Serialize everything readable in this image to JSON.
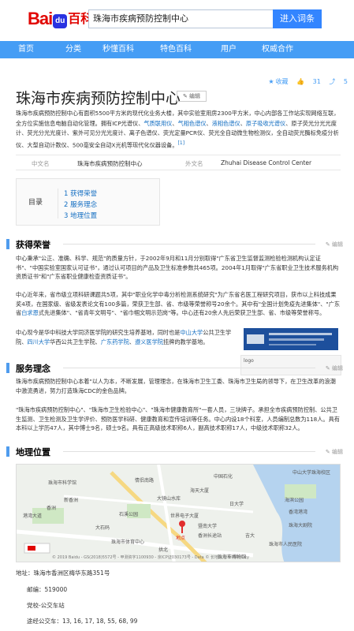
{
  "header": {
    "logo_brand": "Bai",
    "logo_paw": "du",
    "logo_suffix": "百科",
    "search_value": "珠海市疾病预防控制中心",
    "enter_button": "进入词条"
  },
  "nav": {
    "items": [
      "首页",
      "分类",
      "秒懂百科",
      "特色百科",
      "用户",
      "权威合作"
    ]
  },
  "actions": {
    "favorite": "收藏",
    "like_count": "31",
    "share_count": "5"
  },
  "title": "珠海市疾病预防控制中心",
  "edit_label": "编辑",
  "summary": {
    "text1": "珠海市疾病预防控制中心有面积5500平方米的现代化业务大楼，其中实验室用房2300平方米，中心内部各工作站实现网络互联，全方位实施信息电脑自动化管理。拥有ICP光谱仪、",
    "link1": "气质联用仪",
    "sep1": "、",
    "link2": "气相色谱仪",
    "sep2": "、",
    "link3": "液相色谱仪",
    "sep3": "、",
    "link4": "原子吸收光谱仪",
    "text2": "、原子荧光分光光度计、荧光分光光度计、紫外可见分光光度计、离子色谱仪、荧光定量PCR仪、荧光全自动微生物检测仪，全自动荧光酶标免疫分析仪、大型自动计数仪、500毫安全自动X光机等现代化仪器设备。",
    "ref": "[1]"
  },
  "basic_info": {
    "cn_name_label": "中文名",
    "cn_name_value": "珠海市疾病预防控制中心",
    "foreign_name_label": "外文名",
    "foreign_name_value": "Zhuhai Disease Control Center"
  },
  "toc": {
    "label": "目录",
    "items": [
      "1  获得荣誉",
      "2  服务理念",
      "3  地理位置"
    ]
  },
  "sections": {
    "honors": {
      "title": "获得荣誉",
      "p1": "中心秉承\"公正、准确、科学、规范\"的质量方针，于2002年9月和11月分别取得\"广东省卫生监督监测检验检测机构认定证书\"、\"中国实验室国家认可证书\"，通过认可项目的产品及卫生标准参数共465项。2004年1月取得\"广东省职业卫生技术服务机构资质证书\"和\"广东省职业健康检查资质证书\"。",
      "p2a": "中心近年来，省市级立项科研课题共5项，其中\"职业化学中毒分析检测系统研究\"为广东省名医工程研究项目，获市以上科技成果奖4项，在国家级、省级发表论文有100多篇，荣获卫生部、省、市级等荣誉称号20余个。其中有\"全国计划免疫先进集体\"、\"广东省",
      "p2link": "白求恩",
      "p2b": "式先进集体\"、\"省青年文明号\"、\"省巾帼文明示范岗\"等。中心还有20余人先后荣获卫生部、省、市级等荣誉称号。",
      "p3a": "中心现今是华中科技大学同济医学院的研究生培养基地，同时也是",
      "p3l1": "中山大学",
      "p3b": "公共卫生学院、",
      "p3l2": "四川大学",
      "p3c": "华西公共卫生学院、",
      "p3l3": "广东药学院",
      "p3d": "、",
      "p3l4": "遵义医学院",
      "p3e": "挂牌的教学基地。",
      "pic_caption": "logo"
    },
    "service": {
      "title": "服务理念",
      "p1": "珠海市疾病预防控制中心本着\"以人为本，不断发展，管理理念，在珠海市卫生工委、珠海市卫生局的领导下，在卫生改革的浪潮中激流勇进，努力打造珠海CDC的金色品牌。",
      "p2": "\"珠海市疾病预防控制中心\"、\"珠海市卫生检验中心\"、\"珠海市健康教育所\"一套人员，三块牌子。承担全市疾病预防控制、公共卫生监测、卫生检测及卫生学评价、预防医学科研、健康教育和宣传培训等任务。中心内设18个科室，人员编制总数为118人。具有本科以上学历47人，其中博士9名，硕士9名。具有正高级技术职称6人，副高技术职称17人，中级技术职称32人。"
    },
    "location": {
      "title": "地理位置",
      "map_labels": [
        "珠海市科学馆",
        "新香洲",
        "香洲",
        "港湾大道",
        "石溪公园",
        "珠海市体育中心",
        "情侣南路",
        "珠海市人民医院",
        "香洲长途站",
        "大镜山水库",
        "世界电子大厦",
        "暨南大学",
        "日大学",
        "珠海市博物馆",
        "中国石化",
        "中山大学珠海校区",
        "珠海大剧院",
        "香湾港湾",
        "海滨公园",
        "吉大",
        "拱北",
        "海天大厦",
        "大石码"
      ],
      "map_copyright": "© 2019 Baidu - GS(2018)5572号 - 甲测资字1100930 - 京ICP证030173号 - Data © 长地万方 & PalmCity",
      "map_pin_label": "地点",
      "address_label": "地址：",
      "address_value": "珠海市香洲区梅华东路351号",
      "postcode_label": "邮编：",
      "postcode_value": "519000",
      "nearby_label": "党校-公交车站",
      "bus_label": "途经公交车：",
      "bus_value": "13, 16, 17, 18, 55, 68, 99"
    }
  }
}
